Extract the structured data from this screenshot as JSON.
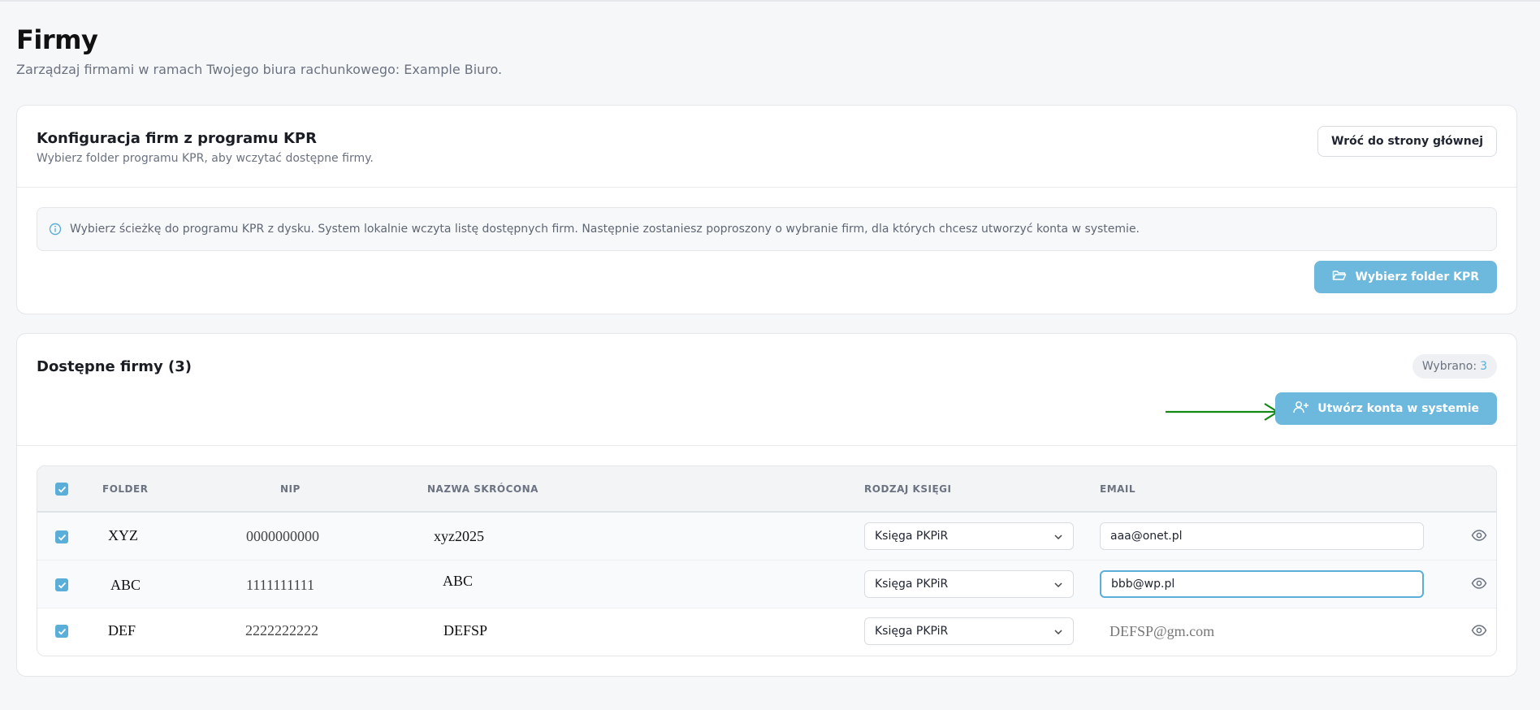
{
  "page": {
    "title": "Firmy",
    "subtitle": "Zarządzaj firmami w ramach Twojego biura rachunkowego: Example Biuro."
  },
  "config_card": {
    "title": "Konfiguracja firm z programu KPR",
    "description": "Wybierz folder programu KPR, aby wczytać dostępne firmy.",
    "back_button": "Wróć do strony głównej",
    "info_text": "Wybierz ścieżkę do programu KPR z dysku. System lokalnie wczyta listę dostępnych firm. Następnie zostaniesz poproszony o wybranie firm, dla których chcesz utworzyć konta w systemie.",
    "select_folder_button": "Wybierz folder KPR"
  },
  "companies_card": {
    "title": "Dostępne firmy (3)",
    "selected_label": "Wybrano:",
    "selected_count": "3",
    "create_button": "Utwórz konta w systemie",
    "columns": {
      "folder": "FOLDER",
      "nip": "NIP",
      "short_name": "NAZWA SKRÓCONA",
      "book_type": "RODZAJ KSIĘGI",
      "email": "EMAIL"
    },
    "rows": [
      {
        "folder": "XYZ",
        "nip": "0000000000",
        "short_name": "xyz2025",
        "book_type": "Księga PKPiR",
        "email": "aaa@onet.pl",
        "checked": true
      },
      {
        "folder": "ABC",
        "nip": "1111111111",
        "short_name": "ABC",
        "book_type": "Księga PKPiR",
        "email": "bbb@wp.pl",
        "checked": true
      },
      {
        "folder": "DEF",
        "nip": "2222222222",
        "short_name": "DEFSP",
        "book_type": "Księga PKPiR",
        "email": "DEFSP@gm.com",
        "checked": true
      }
    ]
  },
  "colors": {
    "accent": "#6db8dd",
    "arrow": "#138a13"
  }
}
